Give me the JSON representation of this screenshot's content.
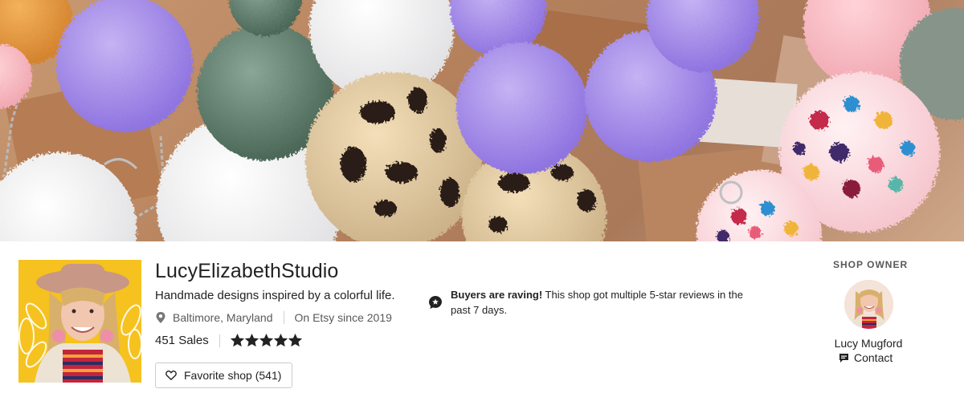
{
  "banner": {
    "image": "pom-pom-keychains-photo"
  },
  "shop": {
    "name": "LucyElizabethStudio",
    "tagline": "Handmade designs inspired by a colorful life.",
    "location": "Baltimore, Maryland",
    "since": "On Etsy since 2019",
    "sales": "451 Sales",
    "rating": 5,
    "favorite_label": "Favorite shop (541)"
  },
  "notice": {
    "bold": "Buyers are raving!",
    "text": " This shop got multiple 5-star reviews in the past 7 days."
  },
  "owner": {
    "label": "SHOP OWNER",
    "name": "Lucy Mugford",
    "contact_label": "Contact"
  },
  "colors": {
    "avatar_bg": "#f5c21f",
    "star": "#222222"
  }
}
